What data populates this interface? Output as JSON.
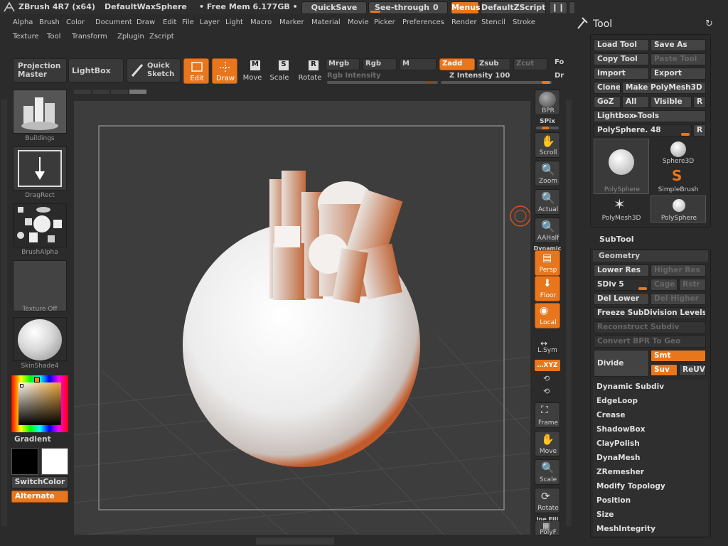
{
  "titlebar": {
    "app": "ZBrush 4R7 (x64)",
    "document": "DefaultWaxSphere",
    "mem": "• Free Mem 6.177GB •",
    "quicksave": "QuickSave",
    "seethrough": "See-through",
    "seethrough_val": "0",
    "seethrough_level": 0,
    "menus": "Menus",
    "script": "DefaultZScript"
  },
  "menu": {
    "row1": [
      "Alpha",
      "Brush",
      "Color",
      "Document",
      "Draw",
      "Edit",
      "File",
      "Layer",
      "Light",
      "Macro",
      "Marker",
      "Material",
      "Movie",
      "Picker",
      "Preferences",
      "Render",
      "Stencil",
      "Stroke"
    ],
    "row2": [
      "Texture",
      "Tool",
      "Transform",
      "Zplugin",
      "Zscript"
    ]
  },
  "toolbar": {
    "projection": "Projection\nMaster",
    "lightbox": "LightBox",
    "quicksketch": "Quick\nSketch",
    "edit": "Edit",
    "draw": "Draw",
    "move": "Move",
    "scale": "Scale",
    "rotate": "Rotate",
    "mrgb": "Mrgb",
    "rgb": "Rgb",
    "m": "M",
    "zadd": "Zadd",
    "zsub": "Zsub",
    "zcut": "Zcut",
    "fo": "Fo",
    "rgb_intensity": "Rgb Intensity",
    "z_intensity": "Z Intensity 100",
    "dr": "Dr"
  },
  "leftshelf": {
    "buildings": "Buildings",
    "dragrect": "DragRect",
    "brushalpha": "BrushAlpha",
    "texture": "Texture Off",
    "skinshade": "SkinShade4",
    "gradient": "Gradient",
    "switchcolor": "SwitchColor",
    "alternate": "Alternate"
  },
  "rightshelf": {
    "bpr": "BPR",
    "spix": "SPix",
    "scroll": "Scroll",
    "zoom": "Zoom",
    "actual": "Actual",
    "aahalf": "AAHalf",
    "dynamic": "Dynamic",
    "persp": "Persp",
    "floor": "Floor",
    "local": "Local",
    "lsym": "L.Sym",
    "xyz": "…XYZ",
    "frame": "Frame",
    "move": "Move",
    "scale": "Scale",
    "rotate": "Rotate",
    "linefill": "Ine Fill",
    "polyf": "PolyF"
  },
  "tool": {
    "title": "Tool",
    "load": "Load Tool",
    "saveas": "Save As",
    "copy": "Copy Tool",
    "paste": "Paste Tool",
    "import": "Import",
    "export": "Export",
    "clone": "Clone",
    "make": "Make PolyMesh3D",
    "goz": "GoZ",
    "all": "All",
    "visible": "Visible",
    "r": "R",
    "lightboxtools": "Lightbox▸Tools",
    "polysphere": "PolySphere. 48",
    "r2": "R",
    "thumbs": [
      "PolySphere",
      "Sphere3D",
      "SimpleBrush",
      "PolyMesh3D",
      "PolySphere"
    ]
  },
  "subtool": {
    "title": "SubTool",
    "geometry": "Geometry",
    "lowerres": "Lower Res",
    "higherres": "Higher Res",
    "sdiv": "SDiv 5",
    "cage": "Cage",
    "rstr": "Rstr",
    "dellower": "Del Lower",
    "delhigher": "Del Higher",
    "freeze": "Freeze SubDivision Levels",
    "reconstruct": "Reconstruct Subdiv",
    "convert": "Convert BPR To Geo",
    "divide": "Divide",
    "smt": "Smt",
    "suv": "Suv",
    "reuv": "ReUV",
    "items": [
      "Dynamic Subdiv",
      "EdgeLoop",
      "Crease",
      "ShadowBox",
      "ClayPolish",
      "DynaMesh",
      "ZRemesher",
      "Modify Topology",
      "Position",
      "Size",
      "MeshIntegrity"
    ]
  }
}
